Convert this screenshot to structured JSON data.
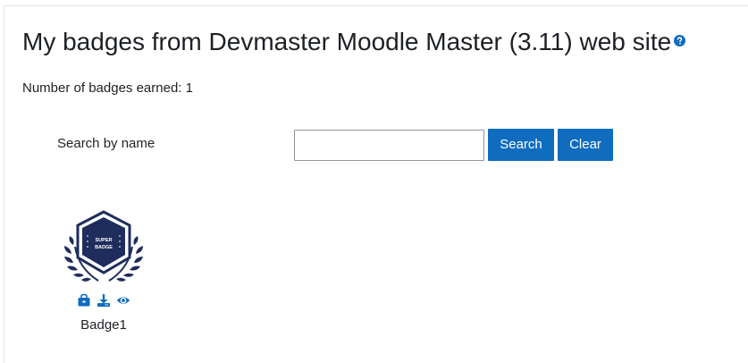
{
  "page": {
    "title": "My badges from Devmaster Moodle Master (3.11) web site",
    "help_icon": "question-circle-icon"
  },
  "summary": {
    "count_text": "Number of badges earned: 1"
  },
  "search": {
    "label": "Search by name",
    "value": "",
    "placeholder": "",
    "search_button": "Search",
    "clear_button": "Clear"
  },
  "badges": [
    {
      "name": "Badge1",
      "image_text_line1": "SUPER",
      "image_text_line2": "BADGE",
      "actions": [
        "add-to-backpack-icon",
        "download-icon",
        "view-icon"
      ]
    }
  ],
  "colors": {
    "primary": "#0f6cbf",
    "text": "#1d2125",
    "badge_navy": "#1e2d5c"
  }
}
